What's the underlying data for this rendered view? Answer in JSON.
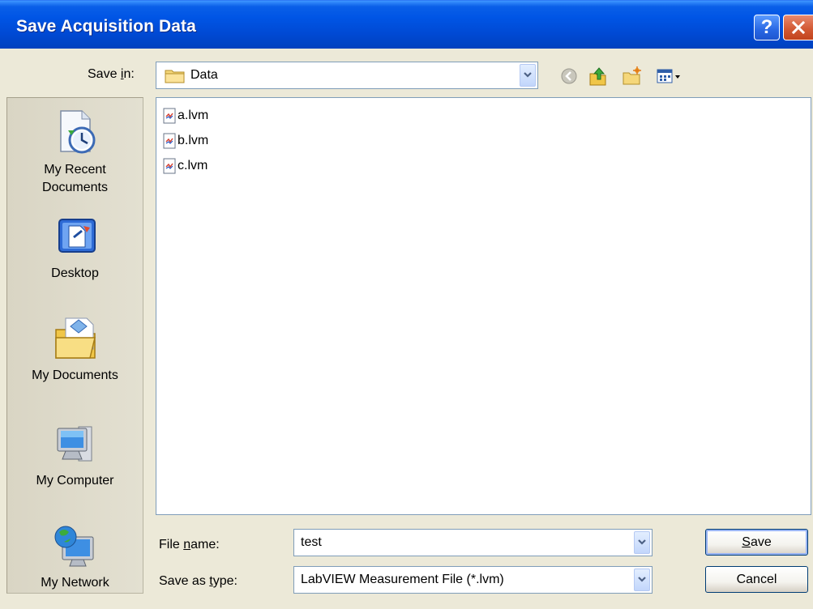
{
  "window": {
    "title": "Save Acquisition Data"
  },
  "save_in": {
    "label_pre": "Save ",
    "label_key": "i",
    "label_post": "n:",
    "value": "Data"
  },
  "toolbar": {
    "icons": [
      "back-icon",
      "up-folder-icon",
      "new-folder-icon",
      "view-menu-icon"
    ]
  },
  "places": [
    {
      "label_line1": "My Recent",
      "label_line2": "Documents",
      "icon": "recent-documents-icon"
    },
    {
      "label_line1": "Desktop",
      "label_line2": "",
      "icon": "desktop-icon"
    },
    {
      "label_line1": "My Documents",
      "label_line2": "",
      "icon": "my-documents-icon"
    },
    {
      "label_line1": "My Computer",
      "label_line2": "",
      "icon": "my-computer-icon"
    },
    {
      "label_line1": "My Network",
      "label_line2": "",
      "icon": "my-network-icon"
    }
  ],
  "files": [
    {
      "name": "a.lvm"
    },
    {
      "name": "b.lvm"
    },
    {
      "name": "c.lvm"
    }
  ],
  "file_name": {
    "label_pre": "File ",
    "label_key": "n",
    "label_post": "ame:",
    "value": "test"
  },
  "save_as_type": {
    "label_pre": "Save as ",
    "label_key": "t",
    "label_post": "ype:",
    "value": "LabVIEW Measurement File (*.lvm)"
  },
  "buttons": {
    "save_key": "S",
    "save_rest": "ave",
    "cancel": "Cancel"
  },
  "colors": {
    "titlebar": "#0055E5",
    "dialog_bg": "#ECE9D8",
    "field_border": "#7F9DB9"
  }
}
